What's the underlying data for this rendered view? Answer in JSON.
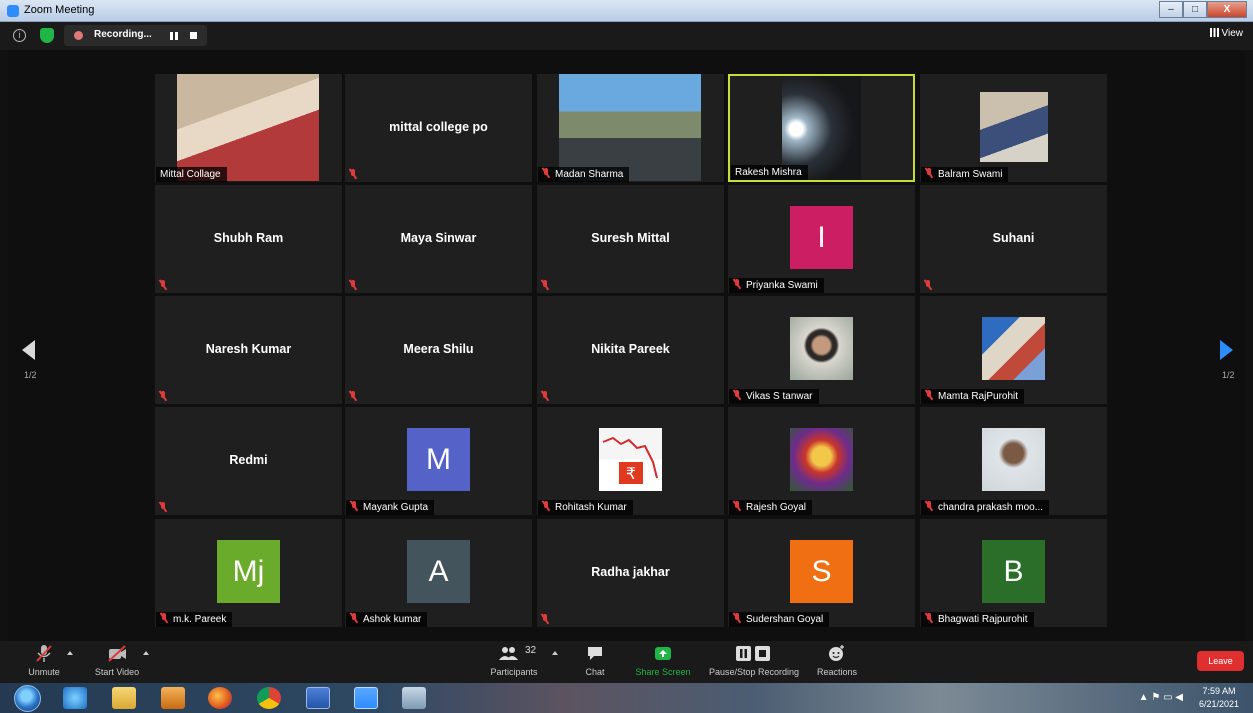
{
  "window": {
    "title": "Zoom Meeting",
    "minimize": "–",
    "maximize": "□",
    "close": "X"
  },
  "topbar": {
    "recording_label": "Recording...",
    "view_label": "View",
    "info_glyph": "i"
  },
  "pager": {
    "left": "1/2",
    "right": "1/2"
  },
  "tiles": [
    {
      "name": "Mittal Collage",
      "kind": "video",
      "muted": false
    },
    {
      "name": "mittal college po",
      "kind": "name",
      "muted": true
    },
    {
      "name": "Madan Sharma",
      "kind": "video",
      "muted": true
    },
    {
      "name": "Rakesh Mishra",
      "kind": "video",
      "muted": false,
      "active": true
    },
    {
      "name": "Balram Swami",
      "kind": "video",
      "muted": true
    },
    {
      "name": "Shubh Ram",
      "kind": "name",
      "muted": true
    },
    {
      "name": "Maya Sinwar",
      "kind": "name",
      "muted": true
    },
    {
      "name": "Suresh Mittal",
      "kind": "name",
      "muted": true
    },
    {
      "name": "Priyanka Swami",
      "kind": "avatar",
      "initials": "I",
      "color": "#cc1f63",
      "muted": true
    },
    {
      "name": "Suhani",
      "kind": "name",
      "muted": true
    },
    {
      "name": "Naresh Kumar",
      "kind": "name",
      "muted": true
    },
    {
      "name": "Meera Shilu",
      "kind": "name",
      "muted": true
    },
    {
      "name": "Nikita Pareek",
      "kind": "name",
      "muted": true
    },
    {
      "name": "Vikas S tanwar",
      "kind": "photo",
      "muted": true
    },
    {
      "name": "Mamta RajPurohit",
      "kind": "photo",
      "muted": true
    },
    {
      "name": "Redmi",
      "kind": "name",
      "muted": true
    },
    {
      "name": "Mayank Gupta",
      "kind": "avatar",
      "initials": "M",
      "color": "#5563c9",
      "muted": true
    },
    {
      "name": "Rohitash Kumar",
      "kind": "photo",
      "muted": true
    },
    {
      "name": "Rajesh Goyal",
      "kind": "photo",
      "muted": true
    },
    {
      "name": "chandra prakash moo...",
      "kind": "photo",
      "muted": true
    },
    {
      "name": "m.k. Pareek",
      "kind": "avatar",
      "initials": "Mj",
      "color": "#6aab2b",
      "muted": true
    },
    {
      "name": "Ashok kumar",
      "kind": "avatar",
      "initials": "A",
      "color": "#44545c",
      "muted": true
    },
    {
      "name": "Radha jakhar",
      "kind": "name",
      "muted": true
    },
    {
      "name": "Sudershan Goyal",
      "kind": "avatar",
      "initials": "S",
      "color": "#f06f12",
      "muted": true
    },
    {
      "name": "Bhagwati Rajpurohit",
      "kind": "avatar",
      "initials": "B",
      "color": "#2b6e2a",
      "muted": true
    }
  ],
  "toolbar": {
    "unmute": "Unmute",
    "start_video": "Start Video",
    "participants": "Participants",
    "participant_count": "32",
    "chat": "Chat",
    "share_screen": "Share Screen",
    "pause_stop_recording": "Pause/Stop Recording",
    "reactions": "Reactions",
    "leave": "Leave"
  },
  "taskbar": {
    "time": "7:59 AM",
    "date": "6/21/2021",
    "apps": [
      "internet-explorer",
      "file-explorer",
      "media-player",
      "firefox",
      "chrome",
      "word",
      "zoom",
      "paint"
    ]
  },
  "colors": {
    "accent": "#2d8cff",
    "active_border": "#c8dd3a",
    "leave": "#e02f2f",
    "share": "#21b548"
  }
}
